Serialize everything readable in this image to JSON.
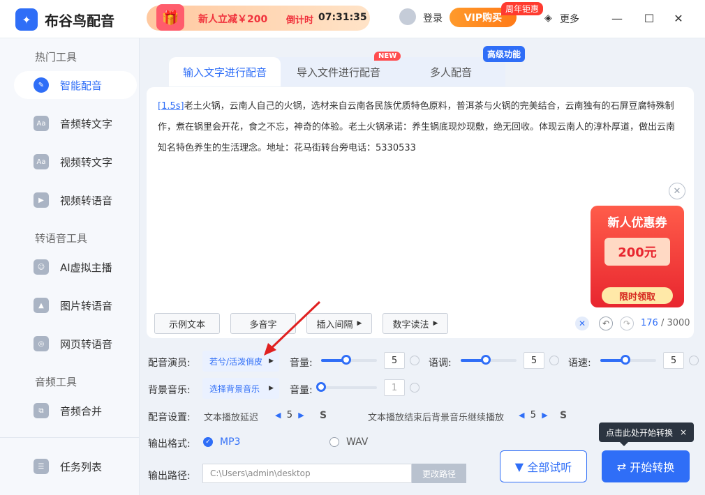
{
  "app": {
    "name": "布谷鸟配音",
    "logo": "bird-logo"
  },
  "promo": {
    "text": "新人立减￥200",
    "countdown_label": "倒计时",
    "countdown": "07:31:35"
  },
  "header": {
    "login": "登录",
    "vip": "VIP购买",
    "vip_tag": "周年钜惠",
    "more": "更多"
  },
  "sidebar": {
    "section1": "热门工具",
    "items1": [
      {
        "label": "智能配音",
        "icon": "smart-dub-icon",
        "active": true
      },
      {
        "label": "音频转文字",
        "icon": "audio-to-text-icon"
      },
      {
        "label": "视频转文字",
        "icon": "video-to-text-icon"
      },
      {
        "label": "视频转语音",
        "icon": "video-to-voice-icon"
      }
    ],
    "section2": "转语音工具",
    "items2": [
      {
        "label": "AI虚拟主播",
        "icon": "ai-anchor-icon"
      },
      {
        "label": "图片转语音",
        "icon": "image-to-voice-icon"
      },
      {
        "label": "网页转语音",
        "icon": "web-to-voice-icon"
      }
    ],
    "section3": "音频工具",
    "items3": [
      {
        "label": "音频合并",
        "icon": "audio-merge-icon"
      }
    ],
    "task_list": "任务列表"
  },
  "tabs": [
    {
      "label": "输入文字进行配音",
      "active": true
    },
    {
      "label": "导入文件进行配音"
    },
    {
      "label": "多人配音"
    }
  ],
  "badges": {
    "new": "NEW",
    "advanced": "高级功能"
  },
  "editor": {
    "pause_tag": "[1.5s]",
    "text": "老土火锅，云南人自己的火锅，选材来自云南各民族优质特色原料，普洱茶与火锅的完美结合，云南独有的石屏豆腐特殊制作，煮在锅里会开花，食之不忘，神奇的体验。老土火锅承诺：养生锅底现炒现敷，绝无回收。体现云南人的淳朴厚道，做出云南知名特色养生的生活理念。地址：花马街转台旁电话：5330533",
    "count": "176",
    "max": "/ 3000"
  },
  "coupon": {
    "title": "新人优惠券",
    "amount": "200元",
    "button": "限时领取"
  },
  "toolbar": {
    "sample": "示例文本",
    "polyphone": "多音字",
    "insert_gap": "插入间隔",
    "read_mode": "数字读法"
  },
  "settings": {
    "voice_label": "配音演员:",
    "voice_value": "若兮/活泼俏皮",
    "volume_label": "音量:",
    "volume": "5",
    "pitch_label": "语调:",
    "pitch": "5",
    "speed_label": "语速:",
    "speed": "5",
    "bgm_label": "背景音乐:",
    "bgm_value": "选择背景音乐",
    "bgm_volume_label": "音量:",
    "bgm_volume": "1",
    "dub_label": "配音设置:",
    "delay_label": "文本播放延迟",
    "delay": "5",
    "delay_unit": "S",
    "continue_label": "文本播放结束后背景音乐继续播放",
    "continue": "5",
    "continue_unit": "S",
    "format_label": "输出格式:",
    "format_mp3": "MP3",
    "format_wav": "WAV",
    "path_label": "输出路径:",
    "path": "C:\\Users\\admin\\desktop",
    "change_path": "更改路径"
  },
  "actions": {
    "listen_all": "全部试听",
    "start": "开始转换",
    "tooltip": "点击此处开始转换",
    "tooltip_close": "×"
  },
  "levels": {
    "volume": 0.45,
    "pitch": 0.45,
    "speed": 0.45,
    "bgm_volume": 0.0
  }
}
